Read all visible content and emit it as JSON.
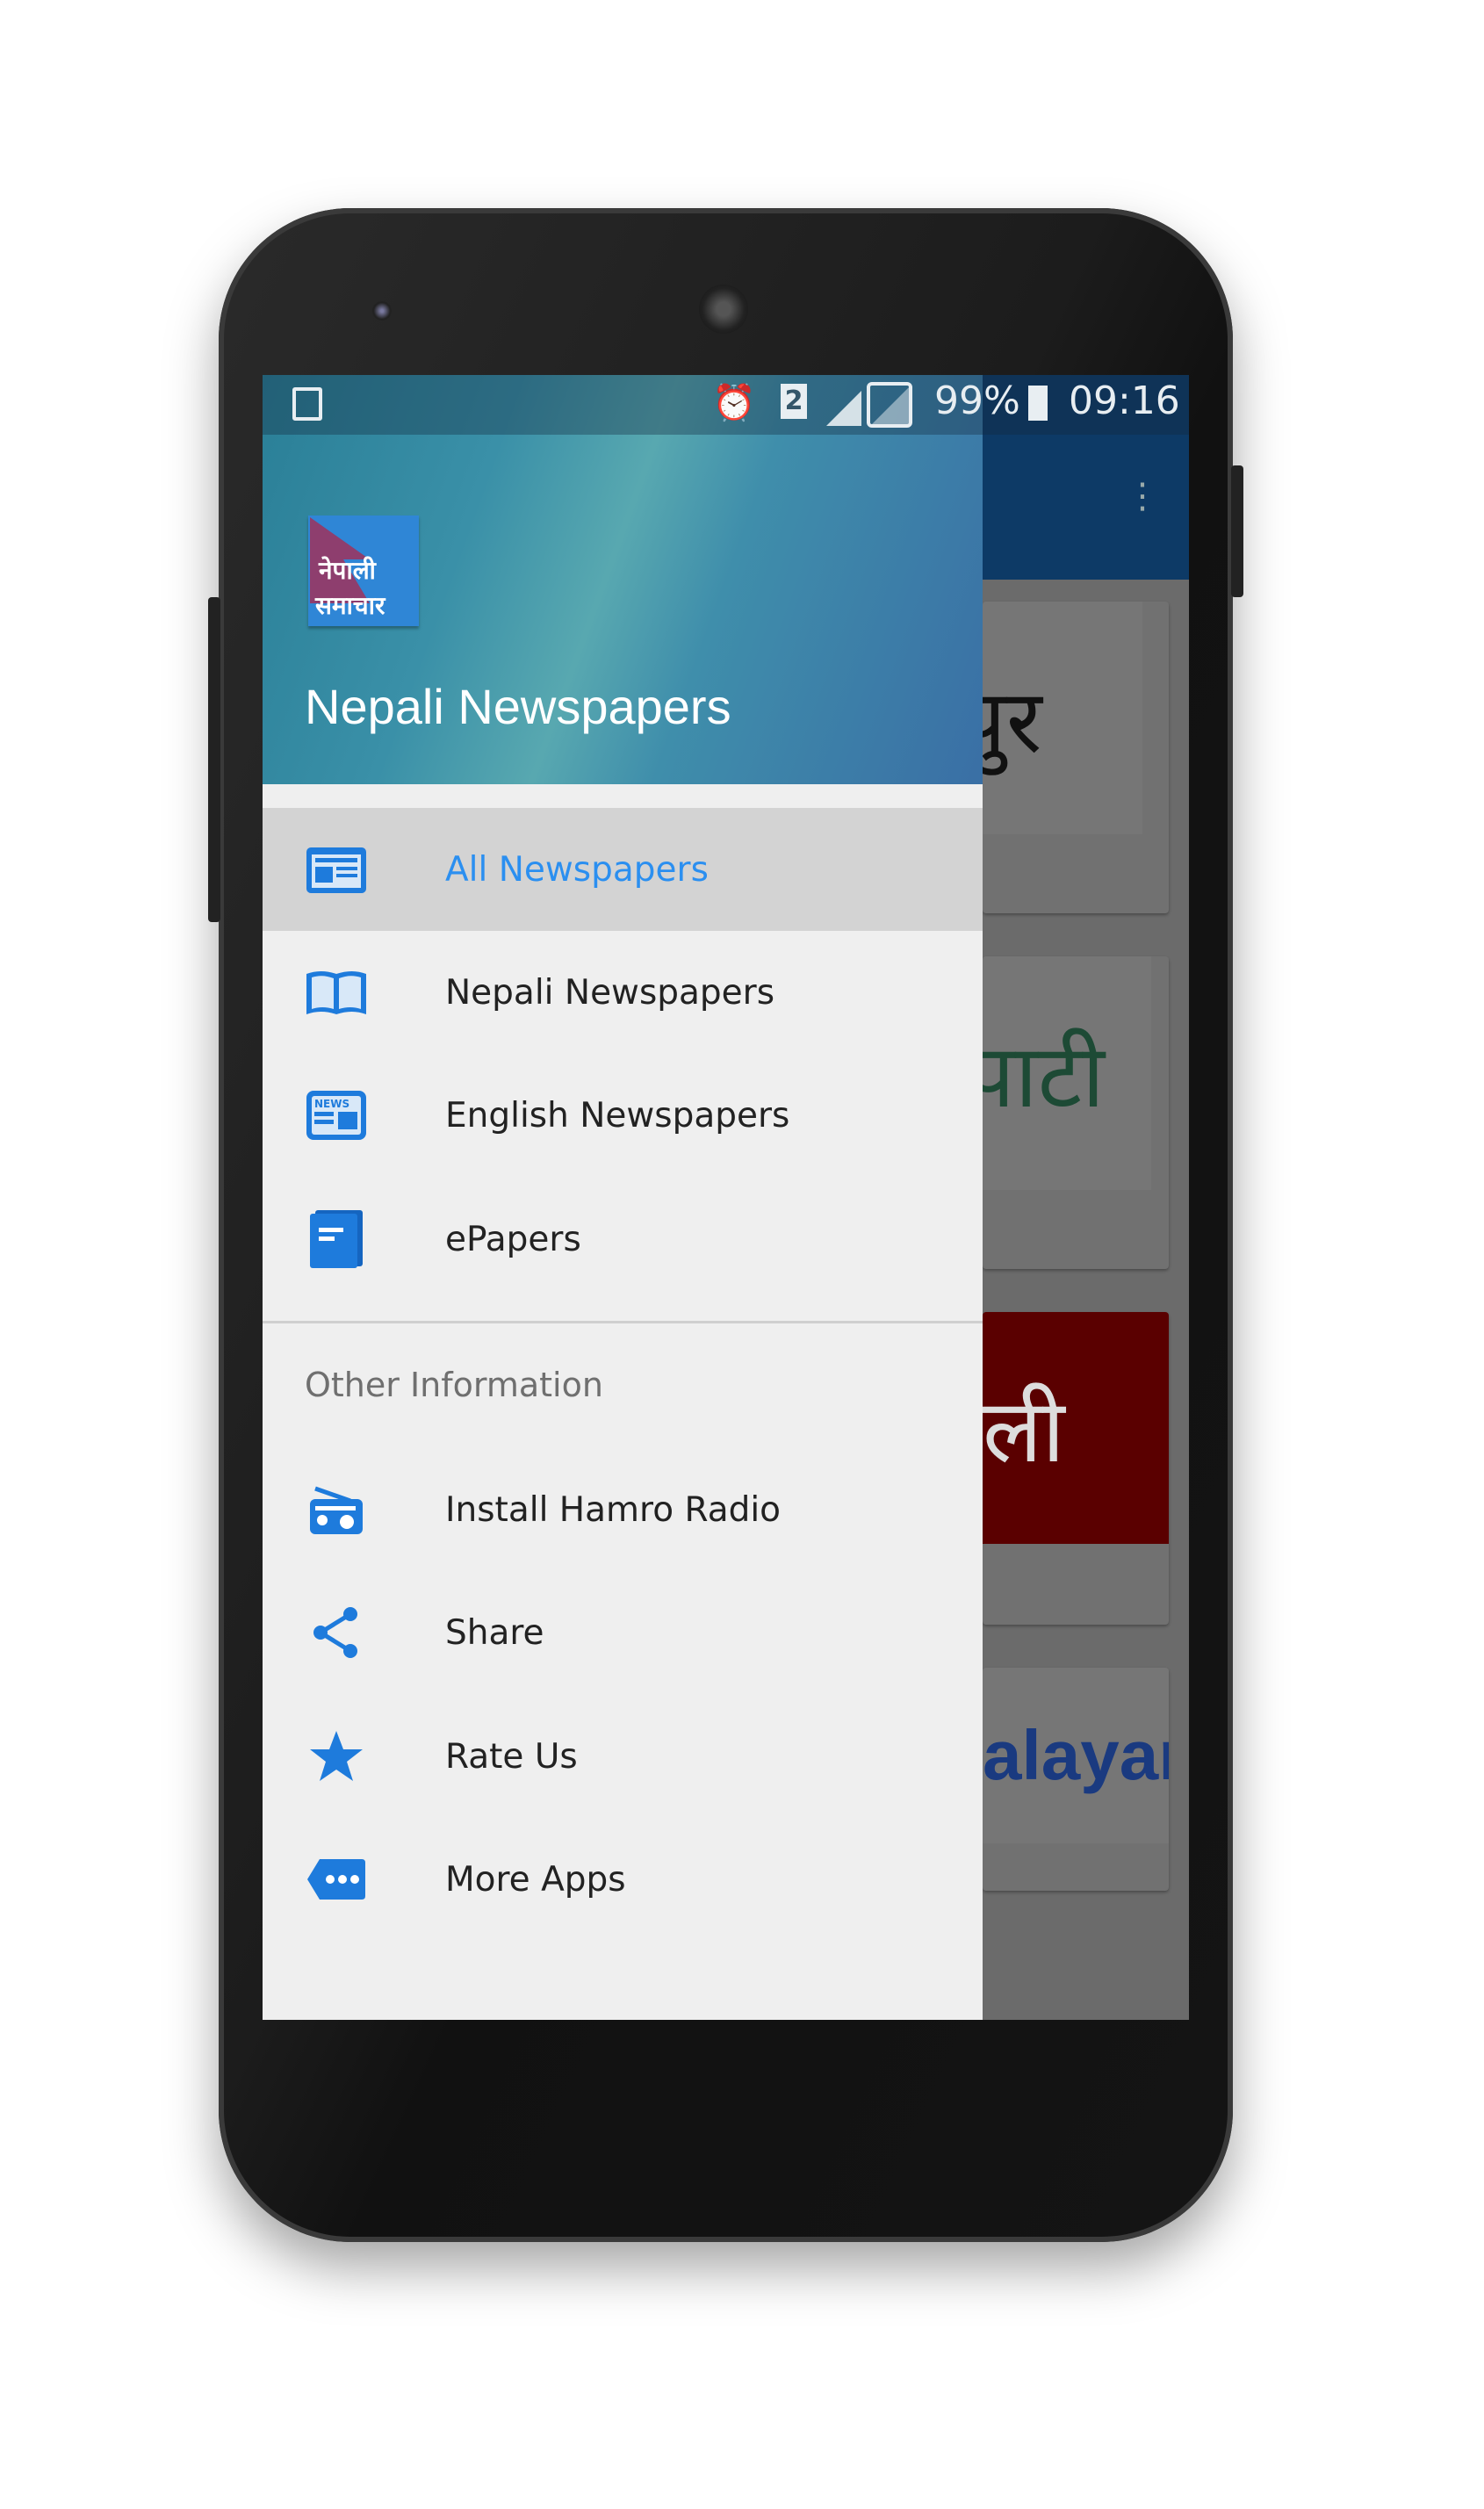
{
  "status_bar": {
    "battery": "99%",
    "time": "09:16",
    "sim": "2"
  },
  "drawer": {
    "title": "Nepali Newspapers",
    "logo_text": [
      "नेपाली",
      "समाचार"
    ],
    "items": [
      {
        "label": "All Newspapers",
        "icon": "newspaper-icon",
        "selected": true
      },
      {
        "label": "Nepali Newspapers",
        "icon": "open-book-icon"
      },
      {
        "label": "English Newspapers",
        "icon": "news-icon"
      },
      {
        "label": "ePapers",
        "icon": "epaper-icon"
      }
    ],
    "section_title": "Other Information",
    "other_items": [
      {
        "label": "Install Hamro Radio",
        "icon": "radio-icon"
      },
      {
        "label": "Share",
        "icon": "share-icon"
      },
      {
        "label": "Rate Us",
        "icon": "star-icon"
      },
      {
        "label": "More Apps",
        "icon": "more-icon"
      }
    ]
  },
  "background_cards": [
    "पुर",
    "पाटी",
    "ली",
    "alayan"
  ],
  "colors": {
    "accent": "#2b8ff0",
    "icon": "#1e7bdc",
    "appbar": "#0d3a66"
  }
}
